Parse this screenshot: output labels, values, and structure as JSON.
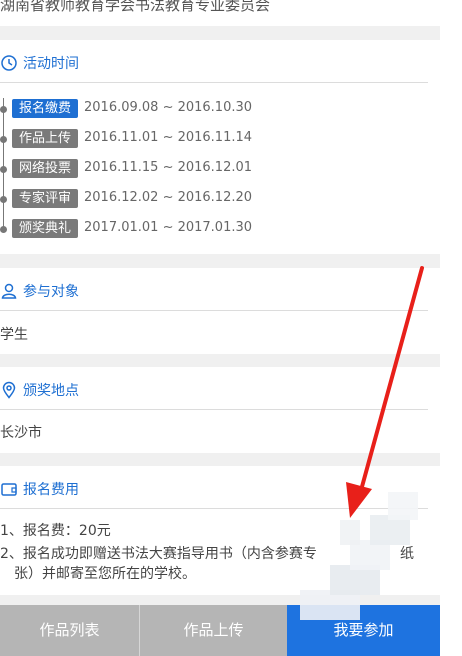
{
  "organizer": "湖南省教师教育学会书法教育专业委员会",
  "schedule": {
    "title": "活动时间",
    "icon": "clock-icon",
    "items": [
      {
        "label": "报名缴费",
        "dates": "2016.09.08 ~ 2016.10.30",
        "active": true
      },
      {
        "label": "作品上传",
        "dates": "2016.11.01 ~ 2016.11.14",
        "active": false
      },
      {
        "label": "网络投票",
        "dates": "2016.11.15 ~ 2016.12.01",
        "active": false
      },
      {
        "label": "专家评审",
        "dates": "2016.12.02 ~ 2016.12.20",
        "active": false
      },
      {
        "label": "颁奖典礼",
        "dates": "2017.01.01 ~ 2017.01.30",
        "active": false
      }
    ]
  },
  "participants": {
    "title": "参与对象",
    "icon": "user-icon",
    "value": "学生"
  },
  "venue": {
    "title": "颁奖地点",
    "icon": "location-pin-icon",
    "value": "长沙市"
  },
  "fees": {
    "title": "报名费用",
    "icon": "wallet-icon",
    "lines": [
      "1、报名费：20元",
      "2、报名成功即赠送书法大赛指导用书（内含参赛专",
      "张）并邮寄至您所在的学校。"
    ],
    "line2_tail": "纸"
  },
  "bottom_bar": {
    "works_list": "作品列表",
    "upload": "作品上传",
    "join": "我要参加"
  },
  "colors": {
    "accent": "#1e6fd2",
    "join_button": "#1e73e0",
    "tab_gray": "#b5b5b5",
    "annotation_arrow": "#e8201a"
  }
}
